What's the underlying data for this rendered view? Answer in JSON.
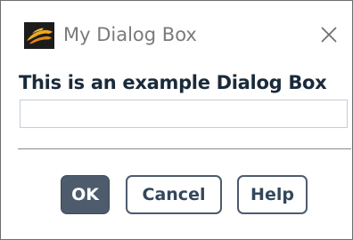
{
  "window": {
    "title": "My Dialog Box",
    "close_icon": "close-icon",
    "app_icon": "ansys-fluent-icon"
  },
  "dialog": {
    "label": "This is an example Dialog Box",
    "input": {
      "value": "",
      "placeholder": ""
    }
  },
  "buttons": {
    "ok_label": "OK",
    "cancel_label": "Cancel",
    "help_label": "Help"
  },
  "colors": {
    "primary_button": "#4d5b6d",
    "button_text": "#33475b",
    "label_text": "#1a2a3a",
    "title_text": "#7a7a7a"
  }
}
